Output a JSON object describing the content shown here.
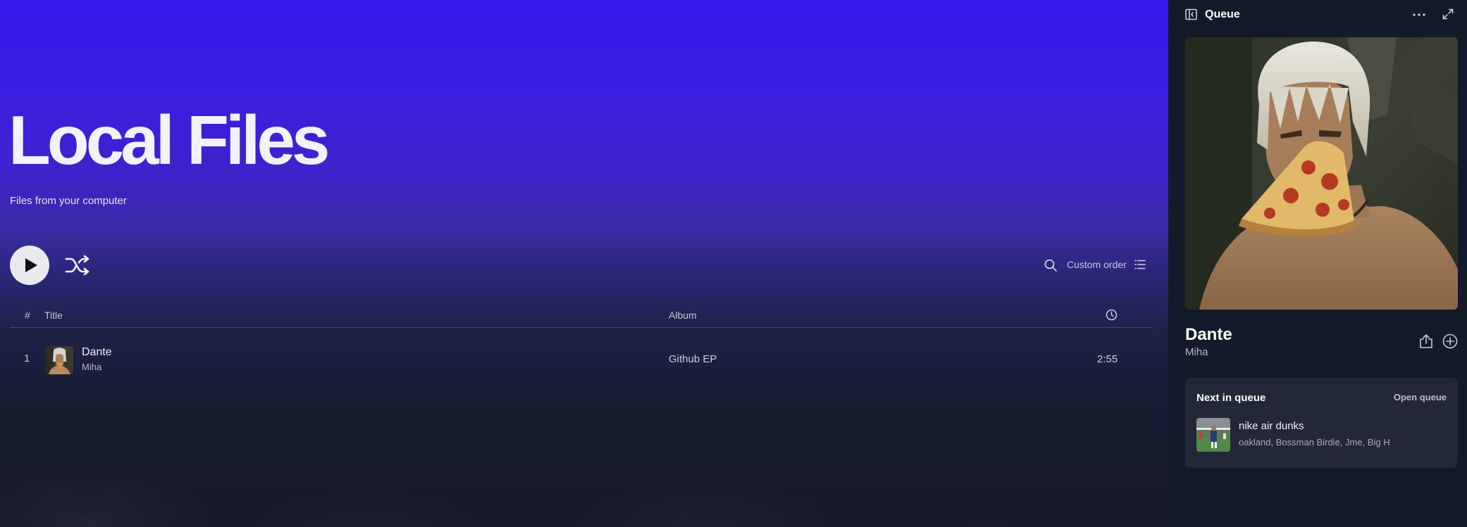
{
  "header": {
    "title": "Local Files",
    "subtitle": "Files from your computer"
  },
  "controls": {
    "sort_label": "Custom order"
  },
  "table": {
    "columns": [
      "#",
      "Title",
      "Album"
    ],
    "rows": [
      {
        "number": "1",
        "title": "Dante",
        "artist": "Miha",
        "album": "Github EP",
        "duration": "2:55"
      }
    ]
  },
  "queue_panel": {
    "title": "Queue",
    "now_playing": {
      "title": "Dante",
      "artist": "Miha"
    },
    "next_section": {
      "title": "Next in queue",
      "open_label": "Open queue",
      "items": [
        {
          "title": "nike air dunks",
          "artists": "oakland, Bossman Birdie, Jme, Big H"
        }
      ]
    }
  },
  "icons": {
    "play": "play-icon",
    "shuffle": "shuffle-icon",
    "search": "search-icon",
    "list": "list-icon",
    "clock": "clock-icon",
    "sidebar": "sidebar-toggle-icon",
    "more": "more-icon",
    "expand": "expand-icon",
    "share": "share-icon",
    "add": "add-circle-icon"
  },
  "colors": {
    "hero_top": "#3617ea",
    "panel_bg": "#131a2a",
    "card_bg": "#222838"
  }
}
